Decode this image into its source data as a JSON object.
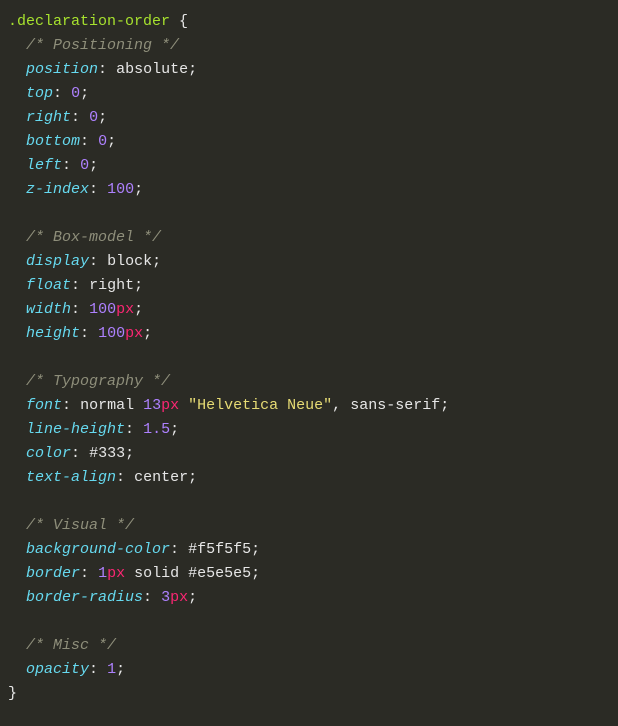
{
  "selector": ".declaration-order",
  "open_brace": "{",
  "close_brace": "}",
  "indent": "  ",
  "groups": [
    {
      "comment": "/* Positioning */",
      "decls": [
        {
          "prop": "position",
          "tokens": [
            {
              "t": "kw",
              "v": "absolute"
            }
          ]
        },
        {
          "prop": "top",
          "tokens": [
            {
              "t": "num",
              "v": "0"
            }
          ]
        },
        {
          "prop": "right",
          "tokens": [
            {
              "t": "num",
              "v": "0"
            }
          ]
        },
        {
          "prop": "bottom",
          "tokens": [
            {
              "t": "num",
              "v": "0"
            }
          ]
        },
        {
          "prop": "left",
          "tokens": [
            {
              "t": "num",
              "v": "0"
            }
          ]
        },
        {
          "prop": "z-index",
          "tokens": [
            {
              "t": "num",
              "v": "100"
            }
          ]
        }
      ]
    },
    {
      "comment": "/* Box-model */",
      "decls": [
        {
          "prop": "display",
          "tokens": [
            {
              "t": "kw",
              "v": "block"
            }
          ]
        },
        {
          "prop": "float",
          "tokens": [
            {
              "t": "kw",
              "v": "right"
            }
          ]
        },
        {
          "prop": "width",
          "tokens": [
            {
              "t": "num",
              "v": "100"
            },
            {
              "t": "unit",
              "v": "px"
            }
          ]
        },
        {
          "prop": "height",
          "tokens": [
            {
              "t": "num",
              "v": "100"
            },
            {
              "t": "unit",
              "v": "px"
            }
          ]
        }
      ]
    },
    {
      "comment": "/* Typography */",
      "decls": [
        {
          "prop": "font",
          "tokens": [
            {
              "t": "kw",
              "v": "normal"
            },
            {
              "t": "sp",
              "v": " "
            },
            {
              "t": "num",
              "v": "13"
            },
            {
              "t": "unit",
              "v": "px"
            },
            {
              "t": "sp",
              "v": " "
            },
            {
              "t": "str",
              "v": "\"Helvetica Neue\""
            },
            {
              "t": "kw",
              "v": ","
            },
            {
              "t": "sp",
              "v": " "
            },
            {
              "t": "kw",
              "v": "sans-serif"
            }
          ]
        },
        {
          "prop": "line-height",
          "tokens": [
            {
              "t": "num",
              "v": "1.5"
            }
          ]
        },
        {
          "prop": "color",
          "tokens": [
            {
              "t": "hex",
              "v": "#333"
            }
          ]
        },
        {
          "prop": "text-align",
          "tokens": [
            {
              "t": "kw",
              "v": "center"
            }
          ]
        }
      ]
    },
    {
      "comment": "/* Visual */",
      "decls": [
        {
          "prop": "background-color",
          "tokens": [
            {
              "t": "hex",
              "v": "#f5f5f5"
            }
          ]
        },
        {
          "prop": "border",
          "tokens": [
            {
              "t": "num",
              "v": "1"
            },
            {
              "t": "unit",
              "v": "px"
            },
            {
              "t": "sp",
              "v": " "
            },
            {
              "t": "kw",
              "v": "solid"
            },
            {
              "t": "sp",
              "v": " "
            },
            {
              "t": "hex",
              "v": "#e5e5e5"
            }
          ]
        },
        {
          "prop": "border-radius",
          "tokens": [
            {
              "t": "num",
              "v": "3"
            },
            {
              "t": "unit",
              "v": "px"
            }
          ]
        }
      ]
    },
    {
      "comment": "/* Misc */",
      "decls": [
        {
          "prop": "opacity",
          "tokens": [
            {
              "t": "num",
              "v": "1"
            }
          ]
        }
      ]
    }
  ]
}
